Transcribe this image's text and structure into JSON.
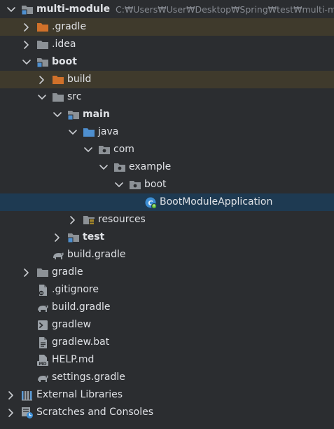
{
  "colors": {
    "background": "#2b2d30",
    "ignored_row": "#3f3a2c",
    "selected_row": "#1e3a52",
    "folder": "#8c9196",
    "source_folder": "#4e8fcf",
    "excluded_folder": "#d0712a"
  },
  "project_tree": {
    "items": [
      {
        "label": "multi-module",
        "path": "C:₩Users₩User₩Desktop₩Spring₩test₩multi-module",
        "bold": true,
        "icon": "module-folder-icon",
        "chevron": "down",
        "state": "normal"
      },
      {
        "label": ".gradle",
        "icon": "excluded-folder-icon",
        "chevron": "right",
        "state": "ignored"
      },
      {
        "label": ".idea",
        "icon": "folder-icon",
        "chevron": "right",
        "state": "normal"
      },
      {
        "label": "boot",
        "bold": true,
        "icon": "module-folder-icon",
        "chevron": "down",
        "state": "normal"
      },
      {
        "label": "build",
        "icon": "excluded-folder-icon",
        "chevron": "right",
        "state": "ignored"
      },
      {
        "label": "src",
        "icon": "folder-icon",
        "chevron": "down",
        "state": "normal"
      },
      {
        "label": "main",
        "bold": true,
        "icon": "module-folder-icon",
        "chevron": "down",
        "state": "normal"
      },
      {
        "label": "java",
        "icon": "source-folder-icon",
        "chevron": "down",
        "state": "normal"
      },
      {
        "label": "com",
        "icon": "package-icon",
        "chevron": "down",
        "state": "normal"
      },
      {
        "label": "example",
        "icon": "package-icon",
        "chevron": "down",
        "state": "normal"
      },
      {
        "label": "boot",
        "icon": "package-icon",
        "chevron": "down",
        "state": "normal"
      },
      {
        "label": "BootModuleApplication",
        "icon": "spring-boot-class-icon",
        "chevron": "none",
        "state": "selected"
      },
      {
        "label": "resources",
        "icon": "resources-folder-icon",
        "chevron": "right",
        "state": "normal"
      },
      {
        "label": "test",
        "bold": true,
        "icon": "module-folder-icon",
        "chevron": "right",
        "state": "normal"
      },
      {
        "label": "build.gradle",
        "icon": "gradle-icon",
        "chevron": "none",
        "state": "normal"
      },
      {
        "label": "gradle",
        "icon": "folder-icon",
        "chevron": "right",
        "state": "normal"
      },
      {
        "label": ".gitignore",
        "icon": "gitignore-file-icon",
        "chevron": "none",
        "state": "normal"
      },
      {
        "label": "build.gradle",
        "icon": "gradle-icon",
        "chevron": "none",
        "state": "normal"
      },
      {
        "label": "gradlew",
        "icon": "shell-script-icon",
        "chevron": "none",
        "state": "normal"
      },
      {
        "label": "gradlew.bat",
        "icon": "text-file-icon",
        "chevron": "none",
        "state": "normal"
      },
      {
        "label": "HELP.md",
        "icon": "markdown-file-icon",
        "chevron": "none",
        "state": "normal"
      },
      {
        "label": "settings.gradle",
        "icon": "gradle-icon",
        "chevron": "none",
        "state": "normal"
      },
      {
        "label": "External Libraries",
        "icon": "external-libraries-icon",
        "chevron": "right",
        "state": "normal"
      },
      {
        "label": "Scratches and Consoles",
        "icon": "scratches-icon",
        "chevron": "right",
        "state": "normal"
      }
    ]
  }
}
